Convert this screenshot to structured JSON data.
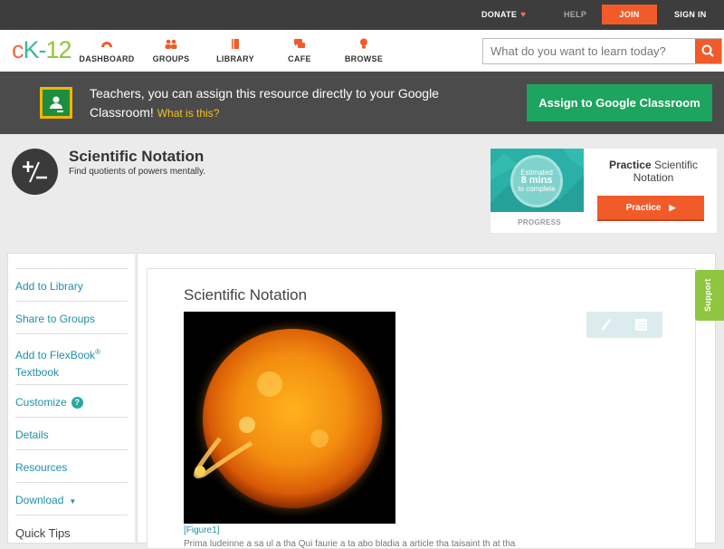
{
  "topbar": {
    "donate": "DONATE",
    "help": "HELP",
    "join": "JOIN",
    "signin": "SIGN IN"
  },
  "logo": {
    "text_c": "c",
    "text_k": "K",
    "text_dash": "-",
    "text_num": "12"
  },
  "nav": [
    {
      "label": "DASHBOARD",
      "icon": "dashboard-icon"
    },
    {
      "label": "GROUPS",
      "icon": "groups-icon"
    },
    {
      "label": "LIBRARY",
      "icon": "library-icon"
    },
    {
      "label": "CAFE",
      "icon": "cafe-icon"
    },
    {
      "label": "BROWSE",
      "icon": "browse-icon"
    }
  ],
  "search": {
    "placeholder": "What do you want to learn today?"
  },
  "classroom_banner": {
    "text": "Teachers, you can assign this resource directly to your Google Classroom!",
    "what_is_this": "What is this?",
    "button": "Assign to Google Classroom"
  },
  "concept": {
    "title": "Scientific Notation",
    "subtitle": "Find quotients of powers mentally."
  },
  "practice_card": {
    "estimated": "Estimated",
    "minutes": "8 mins",
    "to_complete": "to complete",
    "progress_label": "PROGRESS",
    "practice_bold": "Practice",
    "practice_rest": "Scientific Notation",
    "button": "Practice"
  },
  "sidebar": {
    "add_to_library": "Add to Library",
    "share_to_groups": "Share to Groups",
    "add_to_flexbook": "Add to FlexBook",
    "reg": "®",
    "textbook": "Textbook",
    "customize": "Customize",
    "customize_help": "?",
    "details": "Details",
    "resources": "Resources",
    "download": "Download",
    "download_arrow": "▼",
    "quick_tips": "Quick Tips"
  },
  "content": {
    "title": "Scientific Notation",
    "figure_label": "[Figure1]",
    "body_text": "Prima ludeinne a sa ul a tha Qui faurie a ta abo bladia a article tha taisaint th at tha"
  },
  "support": "Support",
  "colors": {
    "accent_orange": "#f15b2a",
    "classroom_green": "#1da45e",
    "link_teal": "#1f8fa6",
    "support_green": "#8ec63f"
  }
}
